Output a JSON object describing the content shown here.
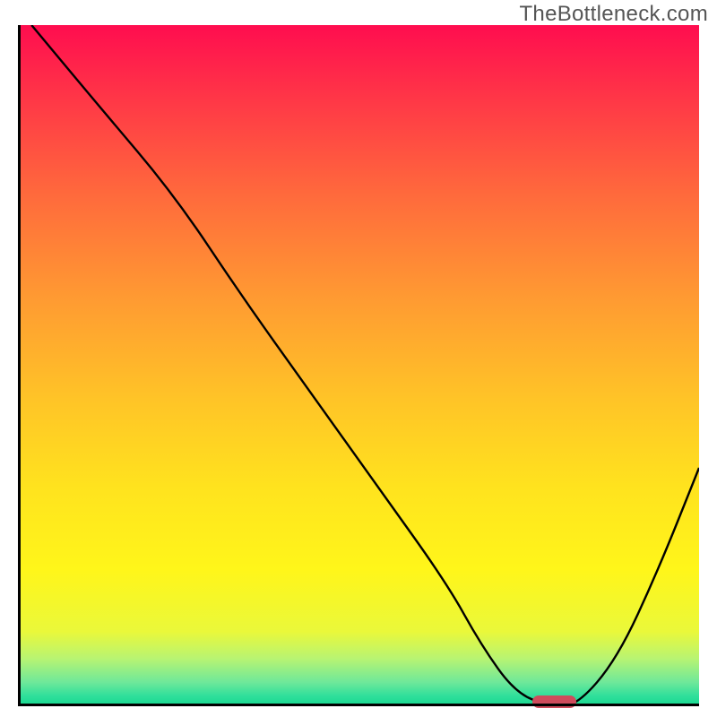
{
  "watermark": "TheBottleneck.com",
  "colors": {
    "watermark_text": "#555555",
    "axis": "#000000",
    "curve": "#000000",
    "marker": "#cf4c5c",
    "gradient_top": "#ff0d4f",
    "gradient_bottom": "#17d88f"
  },
  "chart_data": {
    "type": "line",
    "title": "",
    "xlabel": "",
    "ylabel": "",
    "xlim": [
      0,
      100
    ],
    "ylim": [
      0,
      100
    ],
    "grid": false,
    "legend": false,
    "series": [
      {
        "name": "curve",
        "x": [
          2,
          12,
          23,
          33,
          43,
          53,
          63,
          68,
          73,
          78,
          82,
          88,
          94,
          100
        ],
        "values": [
          100,
          88,
          75,
          60,
          46,
          32,
          18,
          9,
          2,
          0,
          0,
          7,
          20,
          35
        ]
      }
    ],
    "marker": {
      "x_start": 75.5,
      "x_end": 82,
      "y": 0
    },
    "annotations": []
  }
}
